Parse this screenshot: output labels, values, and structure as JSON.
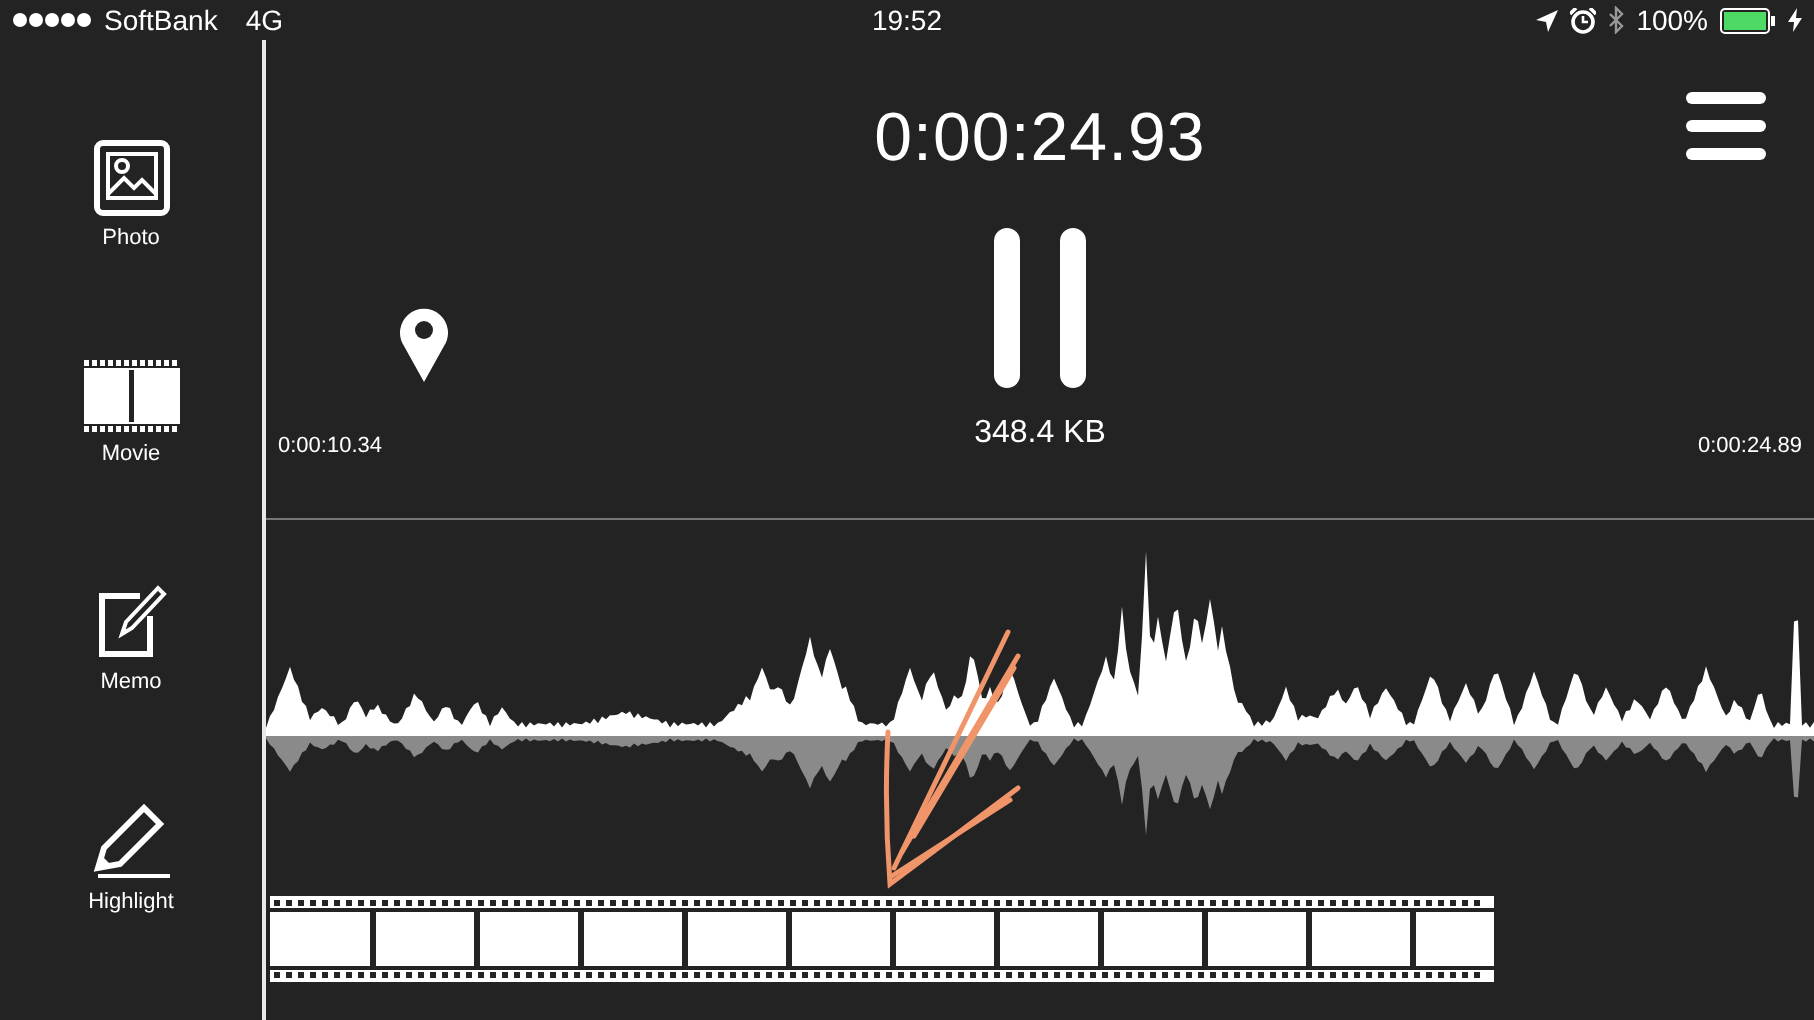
{
  "status_bar": {
    "carrier": "SoftBank",
    "network": "4G",
    "time": "19:52",
    "battery": "100%"
  },
  "sidebar": {
    "items": [
      {
        "kind": "photo",
        "label": "Photo"
      },
      {
        "kind": "movie",
        "label": "Movie"
      },
      {
        "kind": "memo",
        "label": "Memo"
      },
      {
        "kind": "highlight",
        "label": "Highlight"
      }
    ]
  },
  "recorder": {
    "elapsed": "0:00:24.93",
    "file_size": "348.4 KB",
    "range_start": "0:00:10.34",
    "range_end": "0:00:24.89"
  }
}
